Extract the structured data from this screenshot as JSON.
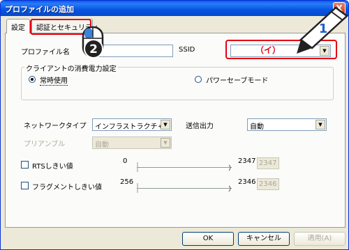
{
  "window": {
    "title": "プロファイルの追加",
    "close_label": "X"
  },
  "tabs": [
    {
      "label": "設定"
    },
    {
      "label": "認証とセキュリティ"
    }
  ],
  "profile": {
    "label": "プロファイル名",
    "value": ""
  },
  "ssid": {
    "label": "SSID",
    "value": ""
  },
  "callouts": {
    "ssid_marker": "（イ）",
    "step1": "1",
    "step2": "2"
  },
  "power": {
    "group_title": "クライアントの消費電力設定",
    "options": [
      {
        "label": "常時使用",
        "selected": true
      },
      {
        "label": "パワーセーブモード",
        "selected": false
      }
    ]
  },
  "network_type": {
    "label": "ネットワークタイプ",
    "value": "インフラストラクチャ"
  },
  "tx_power": {
    "label": "送信出力",
    "value": "自動"
  },
  "preamble": {
    "label": "プリアンブル",
    "value": "自動"
  },
  "rts": {
    "label": "RTSしきい値",
    "min": "0",
    "max": "2347",
    "value": "2347"
  },
  "frag": {
    "label": "フラグメントしきい値",
    "min": "256",
    "max": "2346",
    "value": "2346"
  },
  "buttons": {
    "ok": "OK",
    "cancel": "キャンセル",
    "apply": "適用(A)"
  },
  "colors": {
    "titlebar": "#0654e0",
    "callout": "#e60012",
    "dialog_bg": "#ece9d8"
  }
}
